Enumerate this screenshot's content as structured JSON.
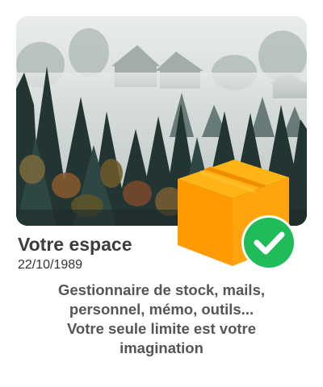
{
  "card": {
    "title": "Votre espace",
    "date": "22/10/1989",
    "description_lines": [
      "Gestionnaire de stock, mails,",
      "personnel, mémo, outils...",
      "Votre seule limite est votre",
      "imagination"
    ],
    "image": "foggy-forest-photo",
    "badge_icon": "package-check-icon"
  },
  "colors": {
    "box_front": "#ff9a00",
    "box_top": "#ffb416",
    "check_badge": "#22c55e",
    "title_text": "#3d3d3d",
    "description_text": "#555555"
  }
}
